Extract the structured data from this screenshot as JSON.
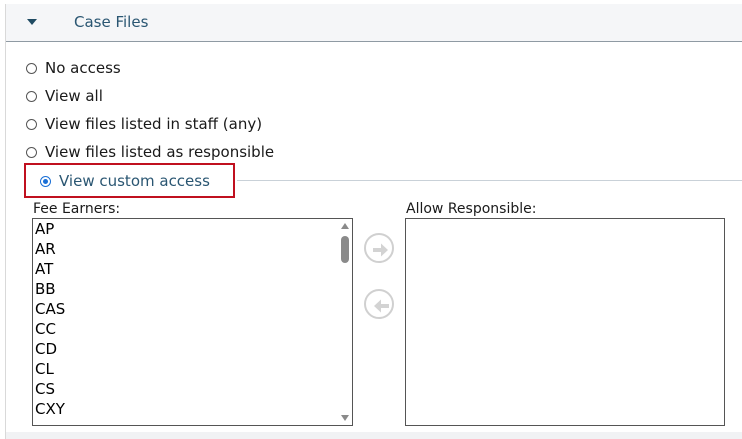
{
  "section": {
    "title": "Case Files"
  },
  "options": [
    {
      "label": "No access",
      "selected": false
    },
    {
      "label": "View all",
      "selected": false
    },
    {
      "label": "View files listed in staff (any)",
      "selected": false
    },
    {
      "label": "View files listed as responsible",
      "selected": false
    },
    {
      "label": "View custom access",
      "selected": true
    }
  ],
  "fee_earners": {
    "label": "Fee Earners:",
    "items": [
      "AP",
      "AR",
      "AT",
      "BB",
      "CAS",
      "CC",
      "CD",
      "CL",
      "CS",
      "CXY"
    ]
  },
  "allow_responsible": {
    "label": "Allow Responsible:",
    "items": []
  },
  "icons": {
    "expand": "caret-down-icon",
    "add": "arrow-right-icon",
    "remove": "arrow-left-icon"
  },
  "colors": {
    "highlight_border": "#c0101f",
    "accent": "#1a6fd6",
    "header_text": "#2a5672"
  }
}
